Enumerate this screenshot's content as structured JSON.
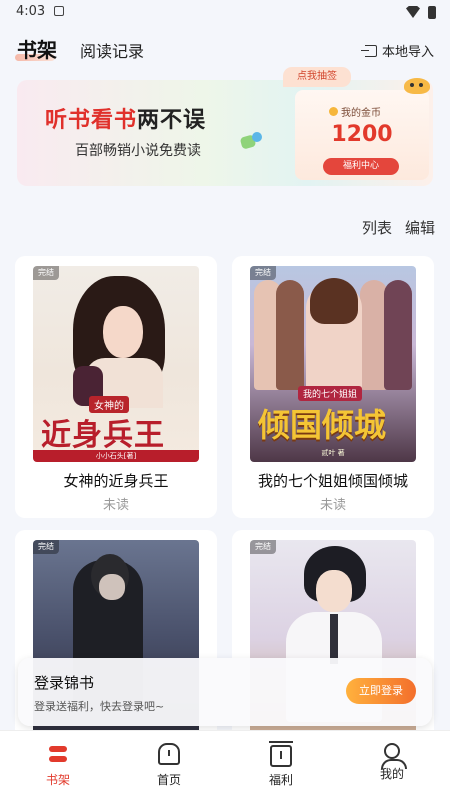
{
  "statusbar": {
    "time": "4:03"
  },
  "header": {
    "tabs": [
      {
        "label": "书架",
        "active": true
      },
      {
        "label": "阅读记录",
        "active": false
      }
    ],
    "import_label": "本地导入"
  },
  "banner": {
    "title_red1": "听书看书",
    "title_dark": "两不误",
    "subtitle": "百部畅销小说免费读",
    "lottery_tag": "点我抽签",
    "coin_label": "我的金币",
    "coin_value": "1200",
    "welfare_button": "福利中心"
  },
  "shelf_actions": {
    "list": "列表",
    "edit": "编辑"
  },
  "books": [
    {
      "title": "女神的近身兵王",
      "status": "未读",
      "badge": "完结",
      "cover_tag": "女神的",
      "cover_text": "近身兵王",
      "cover_author": "小小石头[著]"
    },
    {
      "title": "我的七个姐姐倾国倾城",
      "status": "未读",
      "badge": "完结",
      "cover_tag": "我的七个姐姐",
      "cover_text": "倾国倾城",
      "cover_author": "贰叶 著"
    },
    {
      "badge": "完结"
    },
    {
      "badge": "完结"
    }
  ],
  "login_prompt": {
    "title": "登录锦书",
    "subtitle": "登录送福利，快去登录吧~",
    "button": "立即登录"
  },
  "bottom_nav": [
    {
      "label": "书架",
      "icon": "bookshelf-icon",
      "active": true
    },
    {
      "label": "首页",
      "icon": "home-icon",
      "active": false
    },
    {
      "label": "福利",
      "icon": "gift-icon",
      "active": false
    },
    {
      "label": "我的",
      "icon": "profile-icon",
      "active": false
    }
  ],
  "colors": {
    "accent": "#e23a2c",
    "login_button": "#f36f2c",
    "coin": "#e2392b"
  }
}
